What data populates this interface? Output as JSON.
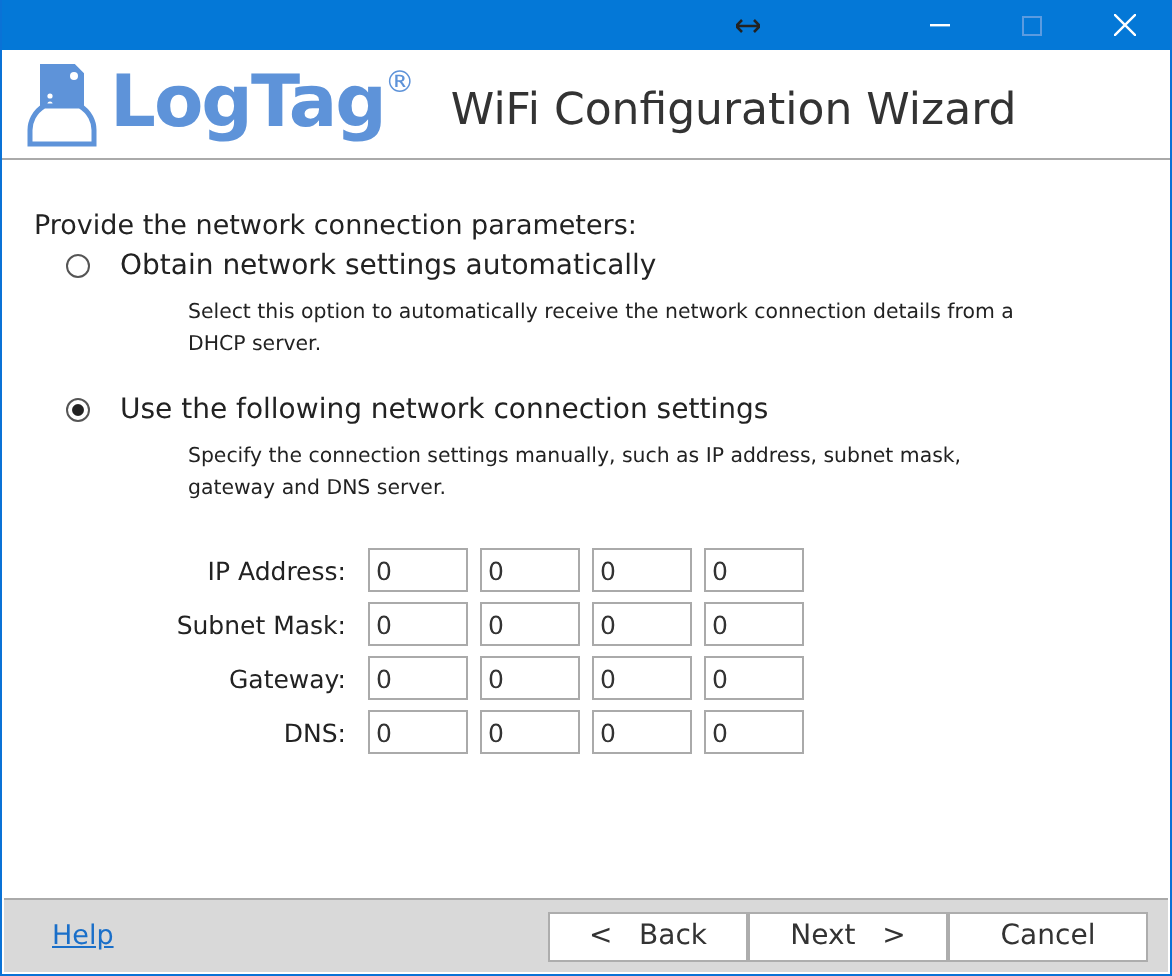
{
  "window": {
    "title_bar": {
      "buttons": [
        {
          "kind": "resize",
          "disabled": false
        },
        {
          "kind": "minimize",
          "disabled": false
        },
        {
          "kind": "maximize",
          "disabled": true
        },
        {
          "kind": "close",
          "disabled": false
        }
      ]
    }
  },
  "header": {
    "logo": "LogTag",
    "logo_mark": "®",
    "title": "WiFi Configuration Wizard"
  },
  "prompt": "Provide the network connection parameters:",
  "options": [
    {
      "label": "Obtain network settings automatically",
      "description": "Select this option to automatically receive the network connection details from a DHCP server.",
      "selected": false
    },
    {
      "label": "Use the following network connection settings",
      "description": "Specify the connection settings manually, such as IP address, subnet mask, gateway and DNS server.",
      "selected": true
    }
  ],
  "fields": [
    {
      "label": "IP Address:",
      "values": [
        "0",
        "0",
        "0",
        "0"
      ]
    },
    {
      "label": "Subnet Mask:",
      "values": [
        "0",
        "0",
        "0",
        "0"
      ]
    },
    {
      "label": "Gateway:",
      "values": [
        "0",
        "0",
        "0",
        "0"
      ]
    },
    {
      "label": "DNS:",
      "values": [
        "0",
        "0",
        "0",
        "0"
      ]
    }
  ],
  "footer": {
    "help": "Help",
    "buttons": [
      {
        "label": "<   Back"
      },
      {
        "label": "Next   >"
      },
      {
        "label": "Cancel"
      }
    ]
  }
}
